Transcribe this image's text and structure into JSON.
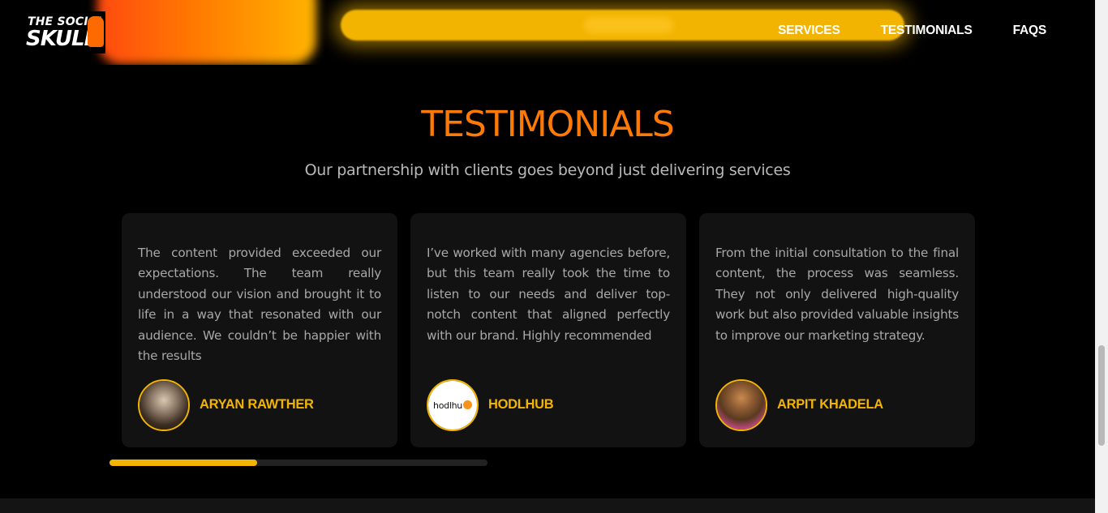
{
  "brand": {
    "line1": "THE SOCIAL",
    "line2": "SKULL"
  },
  "nav": {
    "links": [
      "SERVICES",
      "TESTIMONIALS",
      "FAQS"
    ]
  },
  "section": {
    "title": "TESTIMONIALS",
    "subtitle": "Our partnership with clients goes beyond just delivering services"
  },
  "testimonials": [
    {
      "text": "The content provided exceeded our expectations. The team really understood our vision and brought it to life in a way that resonated with our audience. We couldn’t be happier with the results",
      "name": "ARYAN RAWTHER",
      "avatar": "person-photo"
    },
    {
      "text": "I’ve worked with many agencies before, but this team really took the time to listen to our needs and deliver top-notch content that aligned perfectly with our brand. Highly recommended",
      "name": "HODLHUB",
      "avatar": "hodlhub-logo",
      "avatar_text": "hodlhu"
    },
    {
      "text": "From the initial consultation to the final content, the process was seamless. They not only delivered high-quality work but also provided valuable insights to improve our marketing strategy.",
      "name": "ARPIT KHADELA",
      "avatar": "person-photo"
    }
  ],
  "carousel": {
    "progress": 0.39
  },
  "colors": {
    "accent_orange": "#ff7a05",
    "accent_yellow": "#f2b400",
    "card_bg": "#121212",
    "bg": "#000000"
  }
}
